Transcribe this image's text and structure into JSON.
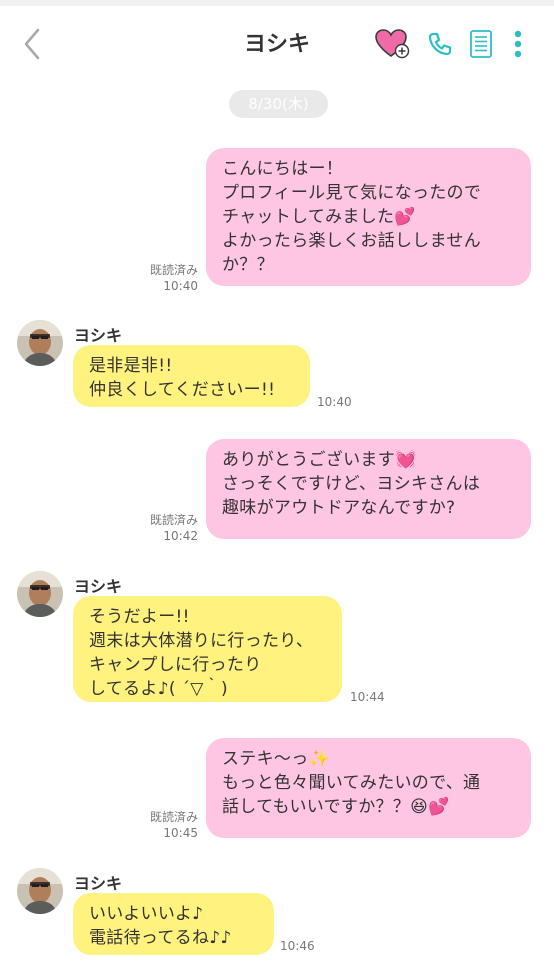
{
  "header": {
    "title": "ヨシキ"
  },
  "date_label": "8/30(木)",
  "messages": [
    {
      "side": "sent",
      "text": "こんにちはー！\nプロフィール見て気になったので\nチャットしてみました💕\nよかったら楽しくお話ししません\nか？？",
      "read": "既読済み",
      "time": "10:40"
    },
    {
      "side": "recv",
      "sender": "ヨシキ",
      "text": "是非是非!!\n仲良くしてくださいー!!",
      "time": "10:40"
    },
    {
      "side": "sent",
      "text": "ありがとうございます💓\nさっそくですけど、ヨシキさんは\n趣味がアウトドアなんですか?",
      "read": "既読済み",
      "time": "10:42"
    },
    {
      "side": "recv",
      "sender": "ヨシキ",
      "text": "そうだよー!!\n週末は大体潜りに行ったり、\nキャンプしに行ったり\nしてるよ♪( ´▽｀)",
      "time": "10:44"
    },
    {
      "side": "sent",
      "text": "ステキ〜っ✨\nもっと色々聞いてみたいので、通\n話してもいいですか？？😆💕",
      "read": "既読済み",
      "time": "10:45"
    },
    {
      "side": "recv",
      "sender": "ヨシキ",
      "text": "いいよいいよ♪\n電話待ってるね♪♪",
      "time": "10:46"
    }
  ],
  "colors": {
    "sent_bubble": "#ffc6e4",
    "recv_bubble": "#fff27f",
    "accent_teal": "#2bbfc4",
    "heart_pink": "#f06aa8"
  },
  "icons": [
    "back-chevron-icon",
    "heart-plus-icon",
    "phone-icon",
    "document-icon",
    "more-vertical-icon"
  ]
}
